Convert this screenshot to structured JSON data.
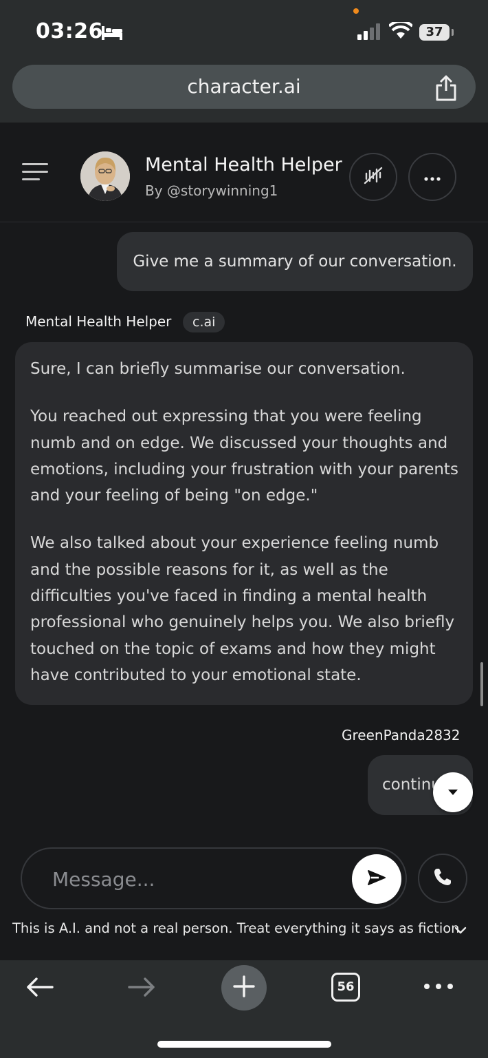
{
  "status_bar": {
    "time": "03:26",
    "battery": "37",
    "icons": [
      "bed-icon",
      "signal-icon",
      "wifi-icon",
      "battery-icon"
    ]
  },
  "browser": {
    "url": "character.ai",
    "share_icon": "share-icon",
    "tab_count": "56",
    "toolbar_icons": [
      "back-arrow-icon",
      "forward-arrow-icon",
      "plus-icon",
      "tabs-icon",
      "more-icon"
    ]
  },
  "chat_header": {
    "menu_icon": "hamburger-menu-icon",
    "character_name": "Mental Health Helper",
    "creator": "By @storywinning1",
    "voice_icon": "voice-muted-icon",
    "more_icon": "ellipsis-icon"
  },
  "messages": [
    {
      "role": "user",
      "text": "Give me a summary of our conversation."
    },
    {
      "role": "bot",
      "name": "Mental Health Helper",
      "badge": "c.ai",
      "paragraphs": [
        "Sure, I can briefly summarise our conversation.",
        "You reached out expressing that you were feeling numb and on edge. We discussed your thoughts and emotions, including your frustration with your parents and your feeling of being \"on edge.\"",
        "We also talked about your experience feeling numb and the possible reasons for it, as well as the difficulties you've faced in finding a mental health professional who genuinely helps you. We also briefly touched on the topic of exams and how they might have contributed to your emotional state."
      ]
    },
    {
      "role": "user",
      "name": "GreenPanda2832",
      "text": "continue"
    }
  ],
  "composer": {
    "placeholder": "Message...",
    "value": "",
    "send_icon": "send-icon",
    "call_icon": "phone-icon"
  },
  "disclaimer": "This is A.I. and not a real person. Treat everything it says as fiction",
  "colors": {
    "background": "#18191b",
    "bubble": "#2e3033",
    "bot_bubble": "#2a2b2e",
    "browser_chrome": "#2a2d2e",
    "notification_dot": "#f08a1c"
  }
}
